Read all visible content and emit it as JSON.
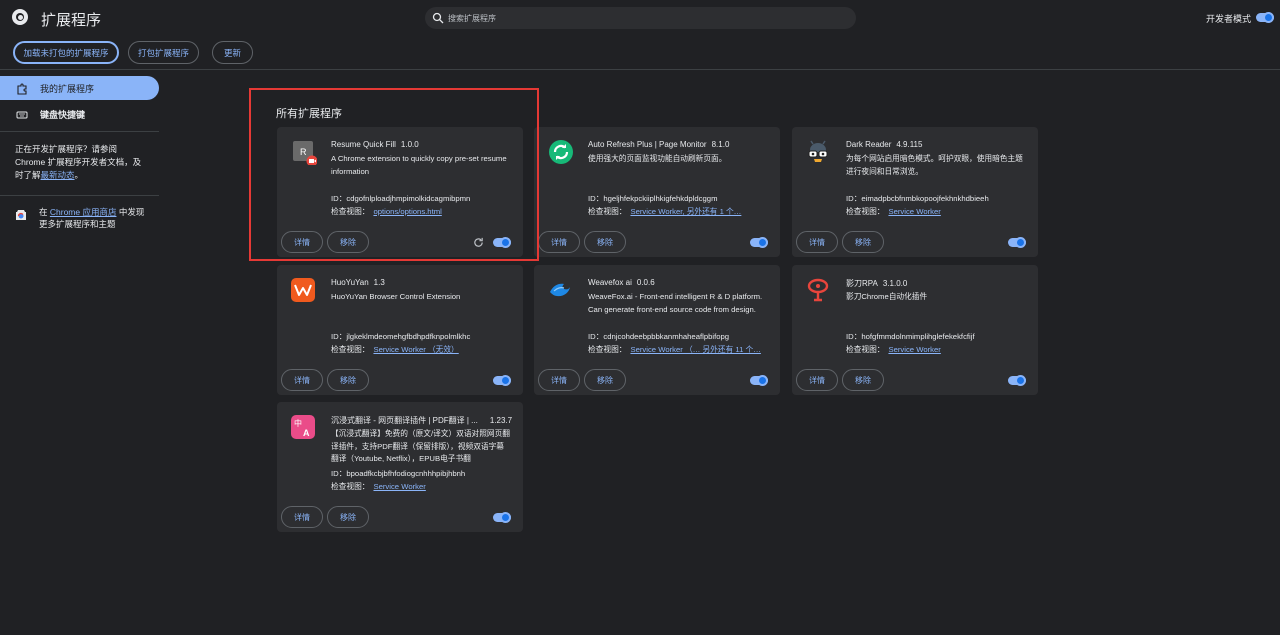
{
  "header": {
    "title": "扩展程序",
    "search_placeholder": "搜索扩展程序",
    "dev_mode_label": "开发者模式"
  },
  "toolbar": {
    "load_unpacked": "加载未打包的扩展程序",
    "pack": "打包扩展程序",
    "update": "更新"
  },
  "sidebar": {
    "items": [
      {
        "label": "我的扩展程序",
        "icon": "puzzle-icon",
        "active": true
      },
      {
        "label": "键盘快捷键",
        "icon": "keyboard-icon",
        "active": false
      }
    ],
    "dev_text_1": "正在开发扩展程序？请参阅 Chrome 扩展程序开发者文档，及时了解",
    "dev_link": "最新动态",
    "dev_text_2": "。",
    "store_text_1": "在 ",
    "store_link": "Chrome 应用商店",
    "store_text_2": " 中发现更多扩展程序和主题"
  },
  "main": {
    "section_title": "所有扩展程序",
    "details_label": "详情",
    "remove_label": "移除",
    "inspect_label": "检查视图：",
    "extensions": [
      {
        "name": "Resume Quick Fill",
        "version": "1.0.0",
        "description": "A Chrome extension to quickly copy pre-set resume information",
        "id": "ID：cdgofnlploadjhmpimolkidcagmibpmn",
        "inspect_link": "options/options.html",
        "icon": "resume-r-icon",
        "enabled": true
      },
      {
        "name": "Auto Refresh Plus | Page Monitor",
        "version": "8.1.0",
        "description": "使用强大的页面监视功能自动刷新页面。",
        "id": "ID：hgeljhfekpckiiplhkigfehkdpldcggm",
        "inspect_link": "Service Worker, 另外还有 1 个…",
        "icon": "refresh-green-icon",
        "enabled": true
      },
      {
        "name": "Dark Reader",
        "version": "4.9.115",
        "description": "为每个网站启用暗色模式。呵护双眼，使用暗色主题进行夜间和日常浏览。",
        "id": "ID：eimadpbcbfnmbkopoojfekhnkhdbieeh",
        "inspect_link": "Service Worker",
        "icon": "dark-reader-icon",
        "enabled": true
      },
      {
        "name": "HuoYuYan",
        "version": "1.3",
        "description": "HuoYuYan Browser Control Extension",
        "id": "ID：jlgkeklmdeomehgfbdhpdfknpolmlkhc",
        "inspect_link": "Service Worker （无效）",
        "icon": "huoyuyan-icon",
        "enabled": true
      },
      {
        "name": "Weavefox ai",
        "version": "0.0.6",
        "description": "WeaveFox.ai - Front-end intelligent R & D platform. Can generate front-end source code from design.",
        "id": "ID：cdnjcohdeebpbbkanmhaheaflpbifopg",
        "inspect_link": "Service Worker （…  另外还有 11 个…",
        "icon": "weavefox-icon",
        "enabled": true
      },
      {
        "name": "影刀RPA",
        "version": "3.1.0.0",
        "description": "影刀Chrome自动化插件",
        "id": "ID：hofgfmmdolnmimplihglefekekfcfijf",
        "inspect_link": "Service Worker",
        "icon": "yingdao-icon",
        "enabled": true
      },
      {
        "name": "沉浸式翻译 - 网页翻译插件 | PDF翻译 | ...",
        "version": "1.23.7",
        "description": "【沉浸式翻译】免费的（原文/译文）双语对照网页翻译插件，支持PDF翻译（保留排版），视频双语字幕翻译（Youtube, Netflix），EPUB电子书翻",
        "id": "ID：bpoadfkcbjbfhfodiogcnhhhpibjhbnh",
        "inspect_link": "Service Worker",
        "icon": "immersive-translate-icon",
        "enabled": true
      }
    ]
  },
  "colors": {
    "accent": "#8ab4f8",
    "highlight_border": "#e53935",
    "card_bg": "#2d2e31",
    "page_bg": "#202124"
  }
}
